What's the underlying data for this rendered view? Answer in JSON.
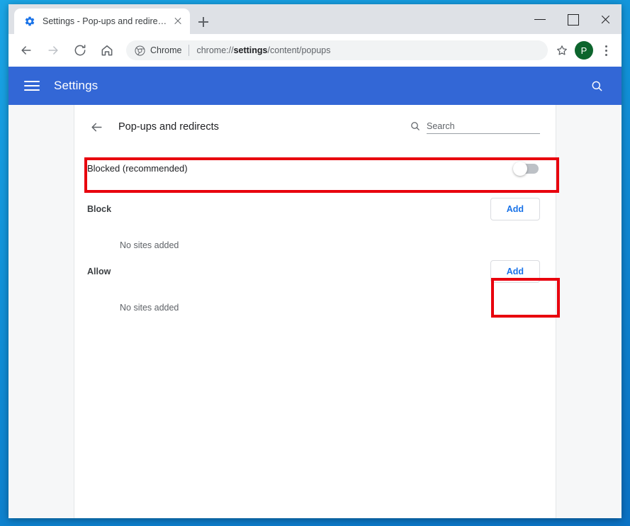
{
  "window": {
    "controls": {
      "minimize": "minimize-button",
      "maximize": "maximize-button",
      "close": "close-button"
    }
  },
  "tab": {
    "title": "Settings - Pop-ups and redirects",
    "favicon": "settings-gear-icon",
    "close_label": "close-tab",
    "new_tab_label": "new-tab"
  },
  "toolbar": {
    "back": "back-icon",
    "forward": "forward-icon",
    "reload": "reload-icon",
    "home": "home-icon",
    "chrome_label": "Chrome",
    "url_prefix": "chrome://",
    "url_emphasis": "settings",
    "url_suffix": "/content/popups",
    "full_url": "chrome://settings/content/popups",
    "bookmark": "star-icon",
    "profile_initial": "P",
    "menu": "three-dot-menu-icon"
  },
  "settings_header": {
    "menu_icon": "hamburger-icon",
    "title": "Settings",
    "search_icon": "search-icon"
  },
  "page": {
    "back_icon": "back-arrow-icon",
    "title": "Pop-ups and redirects",
    "search": {
      "icon": "search-icon",
      "placeholder": "Search",
      "value": ""
    },
    "toggle": {
      "label": "Blocked (recommended)",
      "state": "off"
    },
    "sections": [
      {
        "title": "Block",
        "add_label": "Add",
        "empty_text": "No sites added"
      },
      {
        "title": "Allow",
        "add_label": "Add",
        "empty_text": "No sites added"
      }
    ]
  },
  "annotations": {
    "highlight_color": "#e8000d",
    "boxes": [
      {
        "name": "blocked-toggle-row-highlight"
      },
      {
        "name": "allow-add-button-highlight"
      }
    ]
  },
  "colors": {
    "settings_header_bg": "#3367d6",
    "accent_blue": "#1a73e8",
    "profile_green": "#0d652d",
    "highlight_red": "#e8000d",
    "page_bg": "#f6f7f8"
  }
}
